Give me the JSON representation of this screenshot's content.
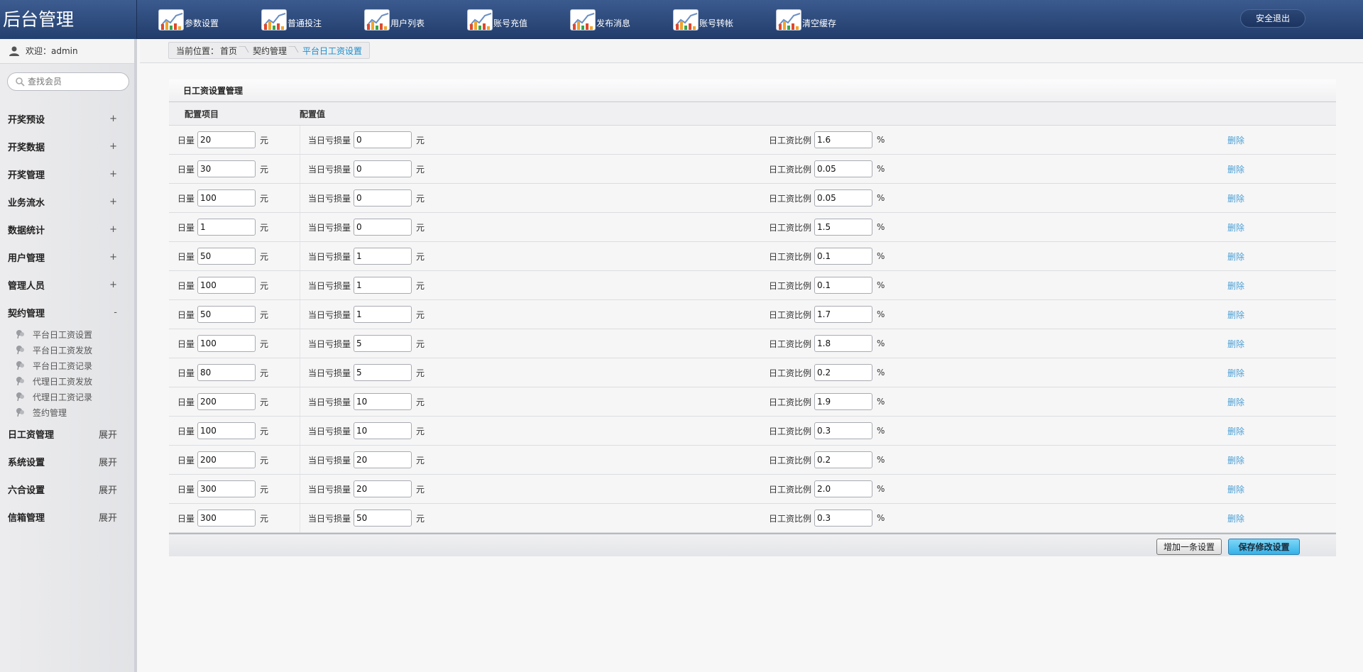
{
  "brand": "后台管理",
  "nav": [
    {
      "label": "参数设置",
      "icon": "chart-icon"
    },
    {
      "label": "普通投注",
      "icon": "chart-icon"
    },
    {
      "label": "用户列表",
      "icon": "chart-icon"
    },
    {
      "label": "账号充值",
      "icon": "chart-icon"
    },
    {
      "label": "发布消息",
      "icon": "chart-icon"
    },
    {
      "label": "账号转帐",
      "icon": "chart-icon"
    },
    {
      "label": "清空缓存",
      "icon": "chart-icon"
    }
  ],
  "logout_label": "安全退出",
  "welcome": "欢迎：admin",
  "search_placeholder": "查找会员",
  "menu": [
    {
      "label": "开奖预设",
      "toggle": "+"
    },
    {
      "label": "开奖数据",
      "toggle": "+"
    },
    {
      "label": "开奖管理",
      "toggle": "+"
    },
    {
      "label": "业务流水",
      "toggle": "+"
    },
    {
      "label": "数据统计",
      "toggle": "+"
    },
    {
      "label": "用户管理",
      "toggle": "+"
    },
    {
      "label": "管理人员",
      "toggle": "+"
    },
    {
      "label": "契约管理",
      "toggle": "-"
    }
  ],
  "submenu": [
    "平台日工资设置",
    "平台日工资发放",
    "平台日工资记录",
    "代理日工资发放",
    "代理日工资记录",
    "签约管理"
  ],
  "menu2": [
    {
      "label": "日工资管理",
      "toggle": "展开"
    },
    {
      "label": "系统设置",
      "toggle": "展开"
    },
    {
      "label": "六合设置",
      "toggle": "展开"
    },
    {
      "label": "信箱管理",
      "toggle": "展开"
    }
  ],
  "breadcrumb": {
    "prefix": "当前位置：",
    "items": [
      "首页",
      "契约管理",
      "平台日工资设置"
    ]
  },
  "panel": {
    "title": "日工资设置管理",
    "col1": "配置项目",
    "col2": "配置值",
    "label_a": "日量",
    "label_b": "当日亏损量",
    "label_c": "日工资比例",
    "unit_yuan": "元",
    "unit_pct": "%",
    "delete_label": "删除",
    "rows": [
      {
        "daily": "20",
        "loss": "0",
        "ratio": "1.6"
      },
      {
        "daily": "30",
        "loss": "0",
        "ratio": "0.05"
      },
      {
        "daily": "100",
        "loss": "0",
        "ratio": "0.05"
      },
      {
        "daily": "1",
        "loss": "0",
        "ratio": "1.5"
      },
      {
        "daily": "50",
        "loss": "1",
        "ratio": "0.1"
      },
      {
        "daily": "100",
        "loss": "1",
        "ratio": "0.1"
      },
      {
        "daily": "50",
        "loss": "1",
        "ratio": "1.7"
      },
      {
        "daily": "100",
        "loss": "5",
        "ratio": "1.8"
      },
      {
        "daily": "80",
        "loss": "5",
        "ratio": "0.2"
      },
      {
        "daily": "200",
        "loss": "10",
        "ratio": "1.9"
      },
      {
        "daily": "100",
        "loss": "10",
        "ratio": "0.3"
      },
      {
        "daily": "200",
        "loss": "20",
        "ratio": "0.2"
      },
      {
        "daily": "300",
        "loss": "20",
        "ratio": "2.0"
      },
      {
        "daily": "300",
        "loss": "50",
        "ratio": "0.3"
      }
    ],
    "add_label": "增加一条设置",
    "save_label": "保存修改设置"
  }
}
